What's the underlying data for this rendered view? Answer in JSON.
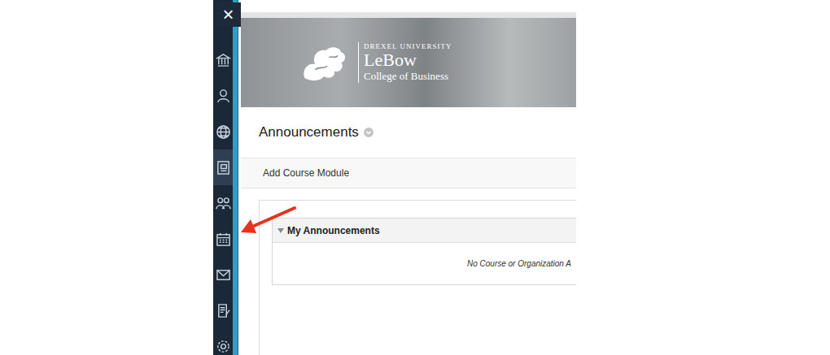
{
  "close_button": {
    "label": "×"
  },
  "sidebar": {
    "items": [
      {
        "selected": false
      },
      {
        "selected": false
      },
      {
        "selected": false
      },
      {
        "selected": true
      },
      {
        "selected": false
      },
      {
        "selected": false
      },
      {
        "selected": false
      },
      {
        "selected": false
      },
      {
        "selected": false
      }
    ]
  },
  "banner": {
    "university": "DREXEL UNIVERSITY",
    "name": "LeBow",
    "school": "College of Business"
  },
  "page": {
    "title": "Announcements",
    "actions": [
      "Add Course Module"
    ]
  },
  "modules": [
    {
      "title": "My Announcements",
      "expanded": true,
      "message": "No Course or Organization A"
    }
  ]
}
